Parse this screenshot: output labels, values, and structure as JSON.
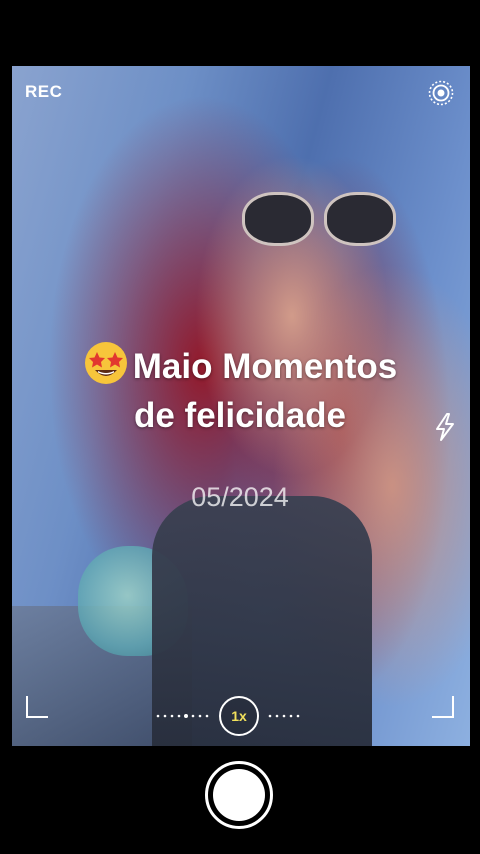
{
  "camera": {
    "rec_label": "REC",
    "zoom_label": "1x",
    "icons": {
      "live": "live-photo-icon",
      "flash": "flash-icon",
      "shutter": "shutter-button",
      "emoji": "star-struck-emoji-icon"
    },
    "accent": "#f2e15c"
  },
  "caption": {
    "line1": "Maio Momentos",
    "line2": "de felicidade",
    "date": "05/2024"
  }
}
